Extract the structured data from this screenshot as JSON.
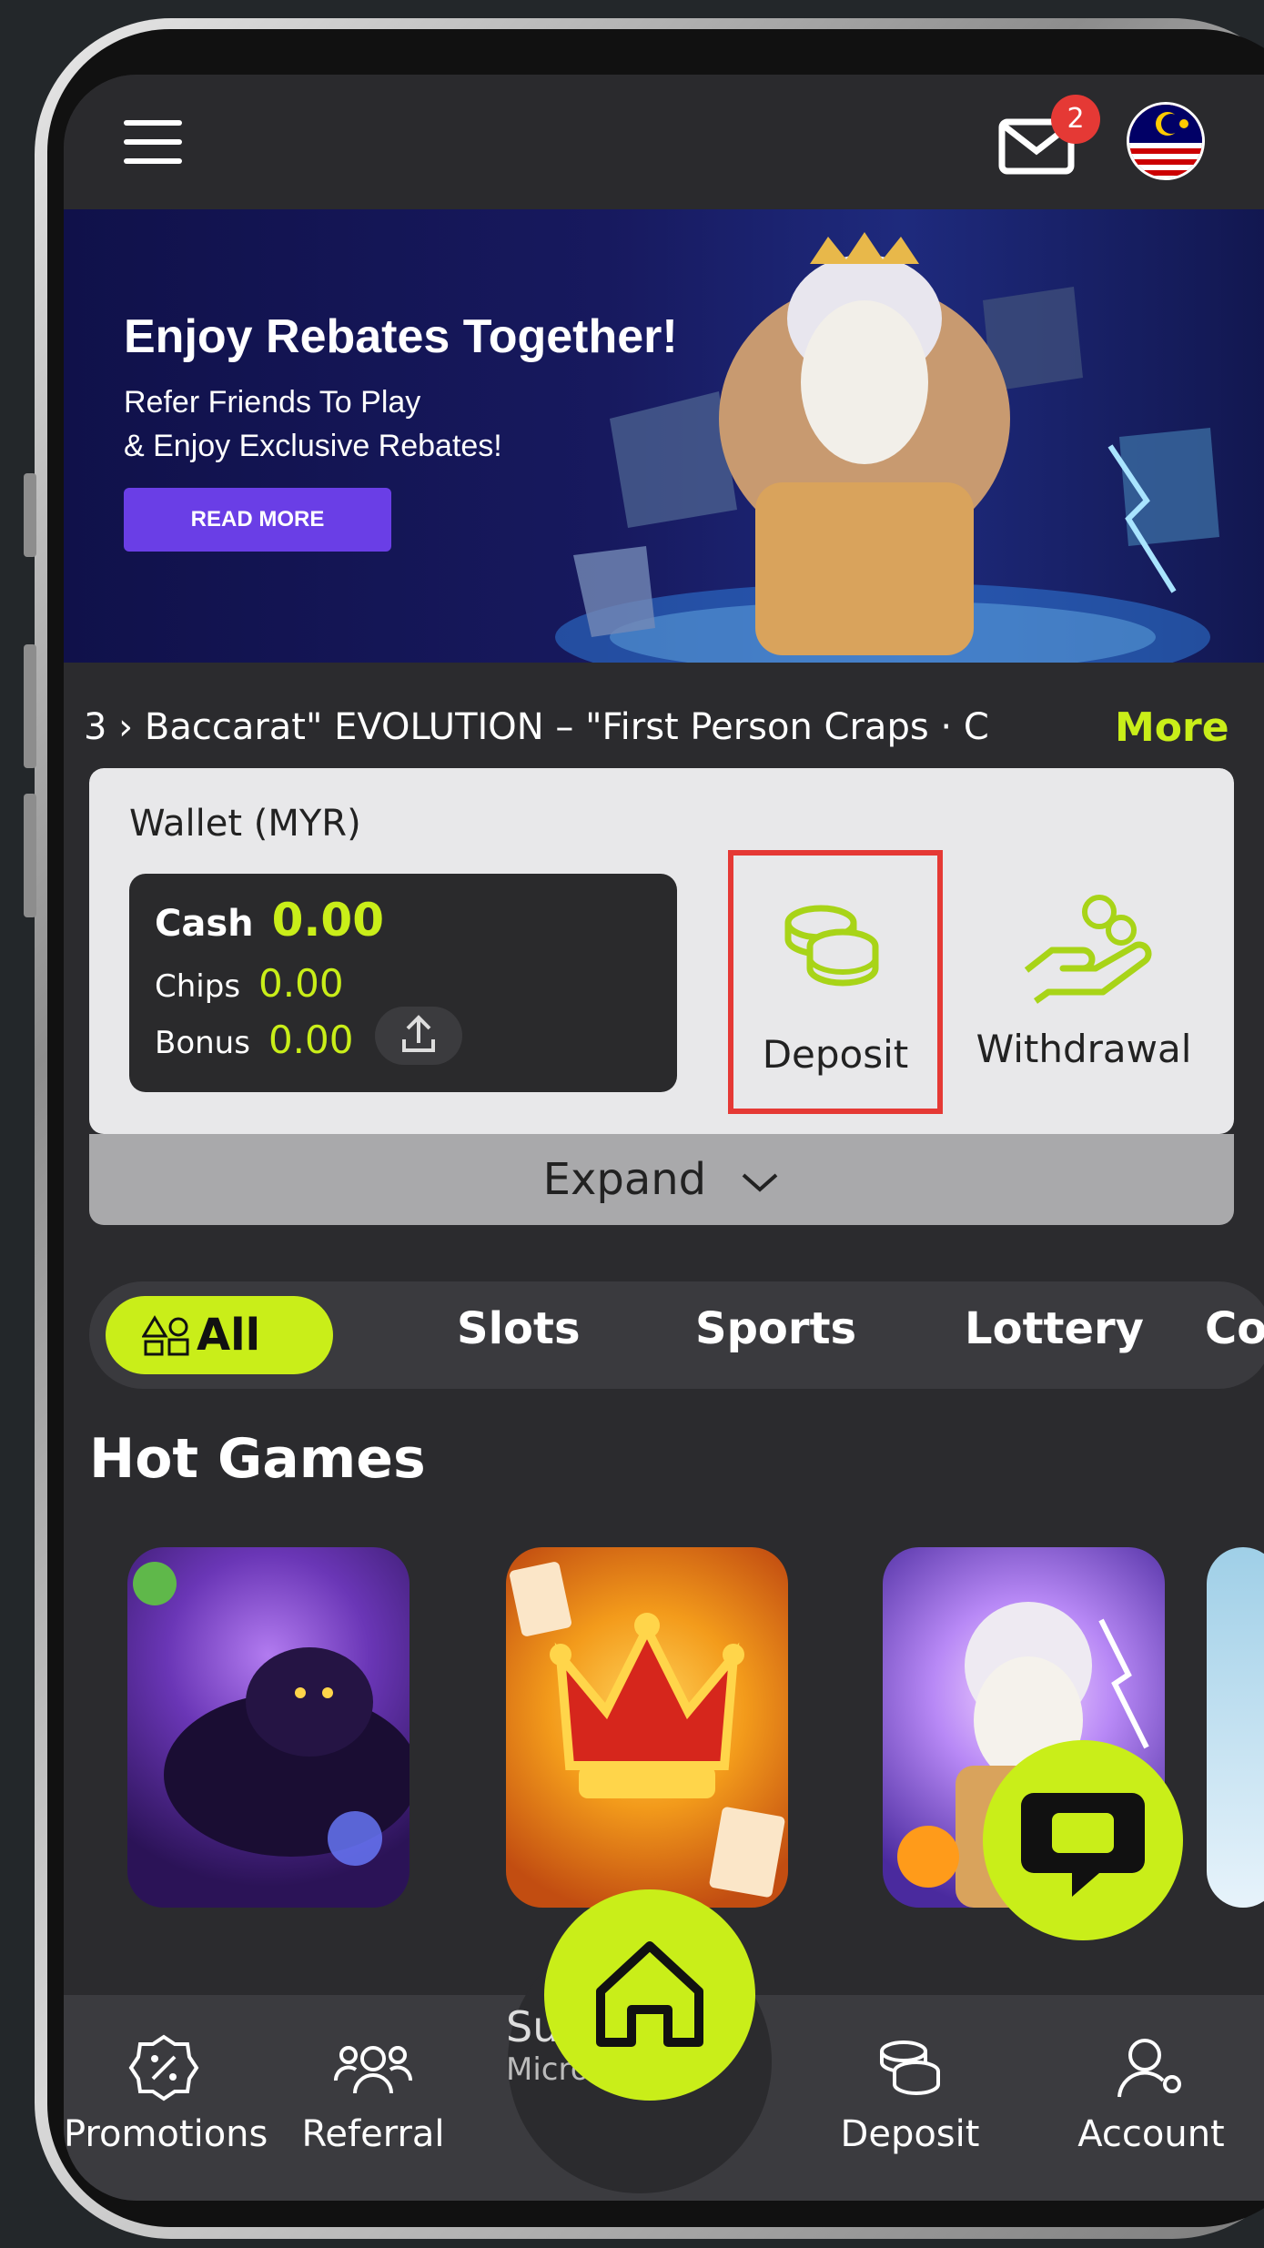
{
  "header": {
    "mail_badge": "2",
    "menu_icon": "hamburger-icon",
    "mail_icon": "mail-icon",
    "flag_icon": "malaysia-flag-icon"
  },
  "banner": {
    "title": "Enjoy Rebates Together!",
    "subtitle_line1": "Refer Friends To Play",
    "subtitle_line2": "& Enjoy Exclusive Rebates!",
    "cta": "READ MORE"
  },
  "ticker": {
    "text": "3 › Baccarat\" EVOLUTION – \"First Person Craps · C",
    "more": "More"
  },
  "wallet": {
    "title": "Wallet (MYR)",
    "cash_label": "Cash",
    "cash_value": "0.00",
    "chips_label": "Chips",
    "chips_value": "0.00",
    "bonus_label": "Bonus",
    "bonus_value": "0.00",
    "deposit_label": "Deposit",
    "withdrawal_label": "Withdrawal",
    "expand_label": "Expand"
  },
  "tabs": [
    {
      "label": "All",
      "active": true
    },
    {
      "label": "Slots"
    },
    {
      "label": "Sports"
    },
    {
      "label": "Lottery"
    },
    {
      "label": "Co"
    }
  ],
  "hot_games": {
    "title": "Hot Games",
    "partial_label": "Su",
    "partial_sublabel": "Micro"
  },
  "bottom_nav": [
    {
      "label": "Promotions",
      "icon": "promotions-icon"
    },
    {
      "label": "Referral",
      "icon": "referral-icon"
    },
    {
      "label": "Deposit",
      "icon": "deposit-coins-icon"
    },
    {
      "label": "Account",
      "icon": "account-icon"
    }
  ],
  "colors": {
    "accent": "#c9ee19",
    "highlight": "#e53935",
    "background": "#2b2b2e"
  }
}
